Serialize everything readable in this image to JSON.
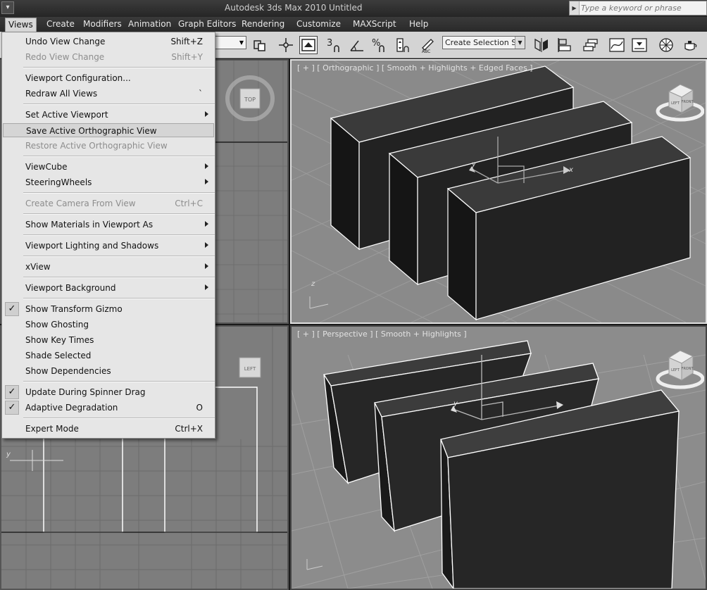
{
  "window": {
    "app_title": "Autodesk 3ds Max  2010",
    "doc_title": "Untitled",
    "search_placeholder": "Type a keyword or phrase"
  },
  "menubar": [
    "Views",
    "Create",
    "Modifiers",
    "Animation",
    "Graph Editors",
    "Rendering",
    "Customize",
    "MAXScript",
    "Help"
  ],
  "toolbar": {
    "selection_set_placeholder": "Create Selection Se",
    "snap_labels": [
      "3",
      "%"
    ]
  },
  "views_menu": {
    "items": [
      {
        "label": "Undo View Change",
        "shortcut": "Shift+Z"
      },
      {
        "label": "Redo View Change",
        "shortcut": "Shift+Y"
      },
      {
        "label": "Viewport Configuration..."
      },
      {
        "label": "Redraw All Views",
        "shortcut": "`"
      },
      {
        "label": "Set Active Viewport"
      },
      {
        "label": "Save Active Orthographic View"
      },
      {
        "label": "Restore Active Orthographic View"
      },
      {
        "label": "ViewCube"
      },
      {
        "label": "SteeringWheels"
      },
      {
        "label": "Create Camera From View",
        "shortcut": "Ctrl+C"
      },
      {
        "label": "Show Materials in Viewport As"
      },
      {
        "label": "Viewport Lighting and Shadows"
      },
      {
        "label": "xView"
      },
      {
        "label": "Viewport Background"
      },
      {
        "label": "Show Transform Gizmo",
        "checked": true
      },
      {
        "label": "Show Ghosting"
      },
      {
        "label": "Show Key Times"
      },
      {
        "label": "Shade Selected"
      },
      {
        "label": "Show Dependencies"
      },
      {
        "label": "Update During Spinner Drag",
        "checked": true
      },
      {
        "label": "Adaptive Degradation",
        "shortcut": "O",
        "checked": true
      },
      {
        "label": "Expert Mode",
        "shortcut": "Ctrl+X"
      }
    ],
    "check_glyph": "✓"
  },
  "viewports": {
    "orthographic": {
      "label": "[ + ] [ Orthographic ] [ Smooth + Highlights + Edged Faces ]",
      "cube_faces": [
        "LEFT",
        "FRONT"
      ]
    },
    "perspective": {
      "label": "[ + ] [ Perspective ] [ Smooth + Highlights ]",
      "cube_faces": [
        "LEFT",
        "FRONT"
      ]
    },
    "top": {
      "cube_face": "TOP"
    },
    "left": {
      "cube_face": "LEFT",
      "axis_y": "y"
    },
    "gizmo": {
      "x": "x",
      "y": "y",
      "z": "z"
    }
  }
}
